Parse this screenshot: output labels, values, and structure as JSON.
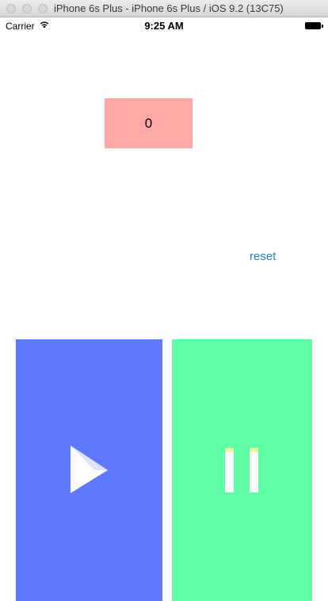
{
  "window": {
    "title": "iPhone 6s Plus - iPhone 6s Plus / iOS 9.2 (13C75)"
  },
  "status_bar": {
    "carrier": "Carrier",
    "time": "9:25 AM",
    "icons": [
      "wifi-icon",
      "battery-icon"
    ]
  },
  "counter": {
    "value": "0",
    "background": "#ffa8a8"
  },
  "reset": {
    "label": "reset",
    "color": "#2a7fbf"
  },
  "play_panel": {
    "icon": "play-icon",
    "background": "#5e78ff"
  },
  "pause_panel": {
    "icon": "pause-icon",
    "background": "#5effa6"
  }
}
